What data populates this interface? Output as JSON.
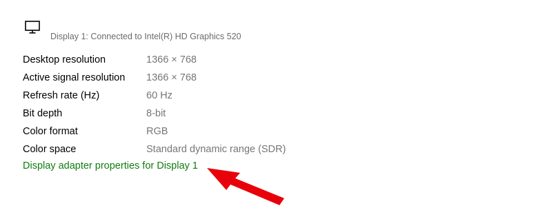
{
  "display": {
    "icon": "monitor-icon",
    "title": "Display 1: Connected to Intel(R) HD Graphics 520"
  },
  "properties": [
    {
      "label": "Desktop resolution",
      "value": "1366 × 768"
    },
    {
      "label": "Active signal resolution",
      "value": "1366 × 768"
    },
    {
      "label": "Refresh rate (Hz)",
      "value": "60 Hz"
    },
    {
      "label": "Bit depth",
      "value": "8-bit"
    },
    {
      "label": "Color format",
      "value": "RGB"
    },
    {
      "label": "Color space",
      "value": "Standard dynamic range (SDR)"
    }
  ],
  "adapter_link": {
    "label": "Display adapter properties for Display 1"
  },
  "colors": {
    "link": "#107c10",
    "annotation_arrow": "#e8000a",
    "value_text": "#767676"
  },
  "annotation": {
    "icon": "red-arrow-icon"
  }
}
